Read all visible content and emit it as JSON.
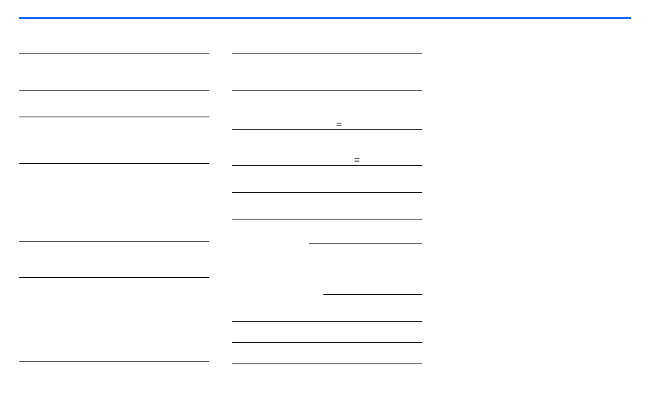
{
  "top_rule": {
    "color": "#1a6cff"
  },
  "symbols": {
    "eq1": "=",
    "eq2": "="
  }
}
